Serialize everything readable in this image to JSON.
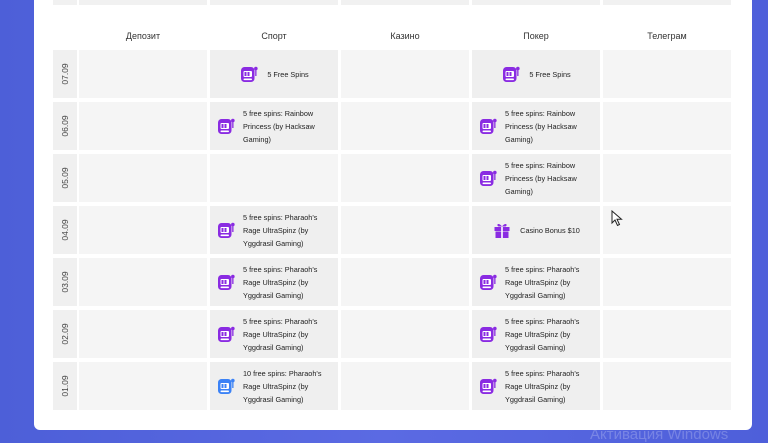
{
  "columns": [
    "Депозит",
    "Спорт",
    "Казино",
    "Покер",
    "Телеграм"
  ],
  "rows": [
    {
      "date": "07.09",
      "sport": {
        "text": "5 Free Spins",
        "icon": "slot-machine-icon"
      },
      "poker": {
        "text": "5 Free Spins",
        "icon": "slot-machine-icon"
      }
    },
    {
      "date": "06.09",
      "sport": {
        "text": "5 free spins: Rainbow Princess (by Hacksaw Gaming)",
        "icon": "slot-machine-icon"
      },
      "poker": {
        "text": "5 free spins: Rainbow Princess (by Hacksaw Gaming)",
        "icon": "slot-machine-icon"
      }
    },
    {
      "date": "05.09",
      "poker": {
        "text": "5 free spins: Rainbow Princess (by Hacksaw Gaming)",
        "icon": "slot-machine-icon"
      }
    },
    {
      "date": "04.09",
      "sport": {
        "text": "5 free spins: Pharaoh's Rage UltraSpinz (by Yggdrasil Gaming)",
        "icon": "slot-machine-icon"
      },
      "poker": {
        "text": "Casino Bonus $10",
        "icon": "gift-icon"
      }
    },
    {
      "date": "03.09",
      "sport": {
        "text": "5 free spins: Pharaoh's Rage UltraSpinz (by Yggdrasil Gaming)",
        "icon": "slot-machine-icon"
      },
      "poker": {
        "text": "5 free spins: Pharaoh's Rage UltraSpinz (by Yggdrasil Gaming)",
        "icon": "slot-machine-icon"
      }
    },
    {
      "date": "02.09",
      "sport": {
        "text": "5 free spins: Pharaoh's Rage UltraSpinz (by Yggdrasil Gaming)",
        "icon": "slot-machine-icon"
      },
      "poker": {
        "text": "5 free spins: Pharaoh's Rage UltraSpinz (by Yggdrasil Gaming)",
        "icon": "slot-machine-icon"
      }
    },
    {
      "date": "01.09",
      "sport": {
        "text": "10 free spins: Pharaoh's Rage UltraSpinz (by Yggdrasil Gaming)",
        "icon": "slot-machine-blue-icon"
      },
      "poker": {
        "text": "5 free spins: Pharaoh's Rage UltraSpinz (by Yggdrasil Gaming)",
        "icon": "slot-machine-icon"
      }
    }
  ],
  "watermark": "Активация Windows",
  "colors": {
    "accent_purple": "#8a2be2",
    "accent_blue": "#3b82f6",
    "background_gradient": "#5064dd",
    "cell_bg": "#f5f5f5"
  }
}
